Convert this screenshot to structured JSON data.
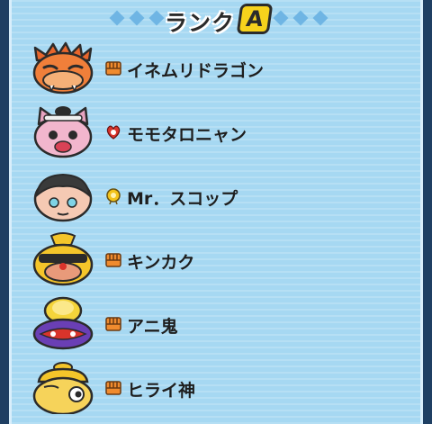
{
  "header": {
    "title": "ランク",
    "rank_letter": "A"
  },
  "list": [
    {
      "name": "イネムリドラゴン",
      "tribe_icon": "fist-tribe-icon",
      "portrait": "dragon-portrait"
    },
    {
      "name": "モモタロニャン",
      "tribe_icon": "heart-tribe-icon",
      "portrait": "cat-portrait"
    },
    {
      "name": "Mr．スコップ",
      "tribe_icon": "spiral-tribe-icon",
      "portrait": "boy-portrait"
    },
    {
      "name": "キンカク",
      "tribe_icon": "fist-tribe-icon",
      "portrait": "gold-oni-portrait"
    },
    {
      "name": "アニ鬼",
      "tribe_icon": "fist-tribe-icon",
      "portrait": "purple-oni-portrait"
    },
    {
      "name": "ヒライ神",
      "tribe_icon": "fist-tribe-icon",
      "portrait": "pot-god-portrait"
    }
  ],
  "colors": {
    "background": "#a6d8f2",
    "fist": "#f08b2e",
    "heart": "#d9342b",
    "spiral": "#f2c31a"
  }
}
